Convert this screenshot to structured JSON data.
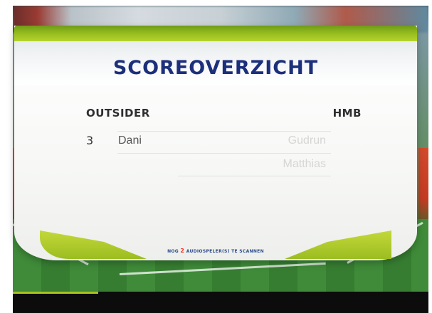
{
  "scoreboard": {
    "title": "SCOREOVERZICHT",
    "teams": {
      "left": {
        "name": "OUTSIDER",
        "score": "3",
        "players": [
          "Dani"
        ]
      },
      "right": {
        "name": "HMB",
        "players": [
          "Gudrun",
          "Matthias"
        ]
      }
    },
    "footer": {
      "prefix": "NOG",
      "count": "2",
      "suffix": "AUDIOSPELER(S) TE SCANNEN"
    }
  },
  "colors": {
    "title": "#1c2f7a",
    "accent_green": "#a8c21d",
    "count_red": "#e03a2a"
  }
}
